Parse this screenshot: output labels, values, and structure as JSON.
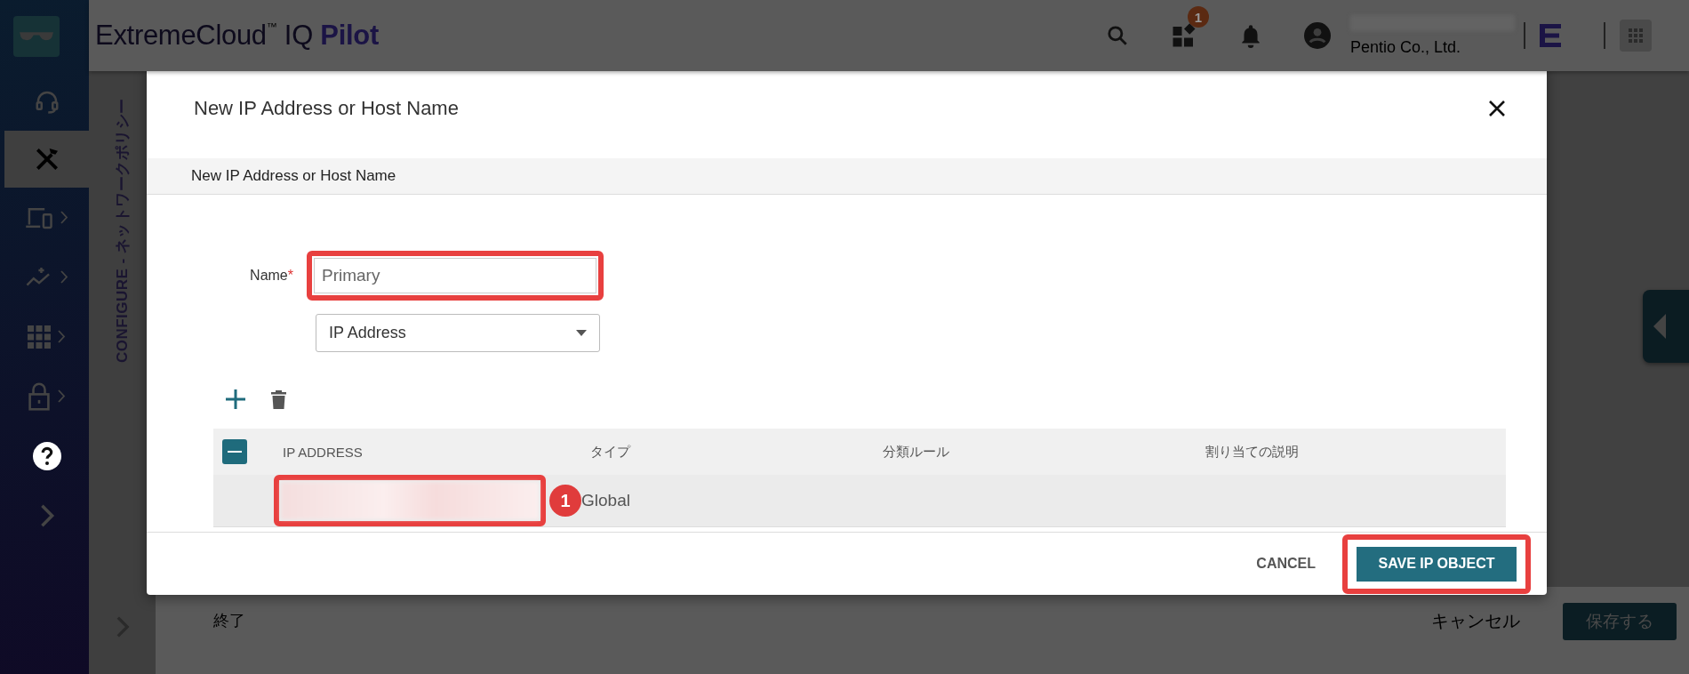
{
  "header": {
    "brand": "ExtremeCloud$^{™}$ IQ **Pilot**",
    "icons": [
      {
        "kind": "search"
      },
      {
        "kind": "apps",
        "badge": "1"
      },
      {
        "kind": "bell"
      },
      {
        "kind": "user"
      }
    ],
    "organization": "Pentio Co., Ltd."
  },
  "sidebar": {
    "items": [
      {
        "kind": "support",
        "selected": false,
        "submenu": false
      },
      {
        "kind": "tools",
        "selected": true,
        "submenu": false
      },
      {
        "kind": "devices",
        "selected": false,
        "submenu": true
      },
      {
        "kind": "analytics",
        "selected": false,
        "submenu": true
      },
      {
        "kind": "apps",
        "selected": false,
        "submenu": true
      },
      {
        "kind": "security",
        "selected": false,
        "submenu": true
      },
      {
        "kind": "help",
        "selected": false,
        "submenu": false
      },
      {
        "kind": "expand",
        "selected": false,
        "submenu": false
      }
    ]
  },
  "page": {
    "title": "CONFIGURE - ネットワークポリシー",
    "footer": {
      "exit": "終了",
      "cancel": "キャンセル",
      "save": "保存する"
    }
  },
  "dialog": {
    "title": "New IP Address or Host Name",
    "section": "New IP Address or Host Name",
    "name": {
      "label": "Name",
      "required_mark": "*",
      "value": "Primary",
      "highlighted": true
    },
    "address_type": "IP Address",
    "table": {
      "all_checkbox": {
        "indeterminate": true
      },
      "columns": [
        "IP ADDRESS",
        "タイプ",
        "分類ルール",
        "割り当ての説明"
      ],
      "rows": [
        {
          "selected": true,
          "highlighted": true,
          "callout": "1",
          "type": "Global"
        }
      ]
    },
    "cancel": "CANCEL",
    "save": {
      "label": "SAVE IP OBJECT",
      "highlighted": true
    }
  }
}
